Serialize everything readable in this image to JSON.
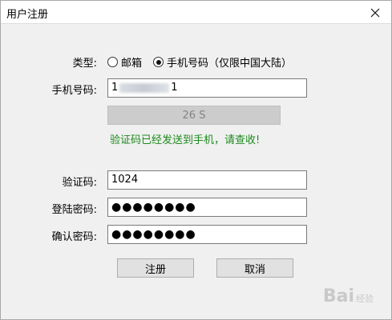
{
  "window": {
    "title": "用户注册",
    "close_icon": "close-icon"
  },
  "form": {
    "type_label": "类型:",
    "type_options": [
      {
        "label": "邮箱",
        "checked": false
      },
      {
        "label": "手机号码（仅限中国大陆）",
        "checked": true
      }
    ],
    "phone_label": "手机号码:",
    "phone_prefix": "1",
    "phone_suffix": "1",
    "countdown_label": "26 S",
    "sent_message": "验证码已经发送到手机，请查收!",
    "code_label": "验证码:",
    "code_value": "1024",
    "password_label": "登陆密码:",
    "password_mask": "●●●●●●●●",
    "confirm_label": "确认密码:",
    "confirm_mask": "●●●●●●●●",
    "register_label": "注册",
    "cancel_label": "取消"
  },
  "watermark": {
    "logo": "Bai",
    "sub": "经验"
  },
  "colors": {
    "success": "#1c8a1c",
    "disabled_button": "#cccccc"
  }
}
